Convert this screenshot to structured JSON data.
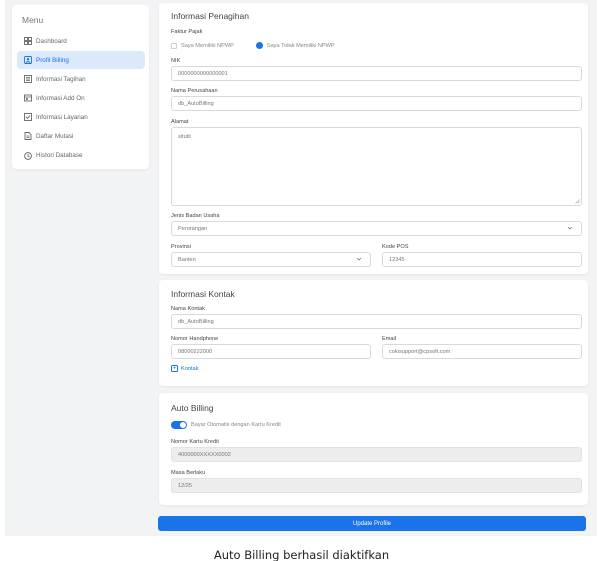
{
  "sidebar": {
    "title": "Menu",
    "items": [
      {
        "label": "Dashboard",
        "icon": "dashboard-icon",
        "active": false
      },
      {
        "label": "Profil Billing",
        "icon": "profile-icon",
        "active": true
      },
      {
        "label": "Informasi Tagihan",
        "icon": "invoice-icon",
        "active": false
      },
      {
        "label": "Informasi Add On",
        "icon": "addon-icon",
        "active": false
      },
      {
        "label": "Informasi Layanan",
        "icon": "service-icon",
        "active": false
      },
      {
        "label": "Daftar Mutasi",
        "icon": "mutation-icon",
        "active": false
      },
      {
        "label": "Histori Database",
        "icon": "history-icon",
        "active": false
      }
    ]
  },
  "billing": {
    "title": "Informasi Penagihan",
    "faktur_label": "Faktur Pajak",
    "option_npwp": "Saya Memiliki NPWP",
    "option_no_npwp": "Saya Tidak Memiliki NPWP",
    "nik_label": "NIK",
    "nik_value": "0000000000000001",
    "company_label": "Nama Perusahaan",
    "company_value": "db_AutoBilling",
    "address_label": "Alamat",
    "address_value": "situtil",
    "business_type_label": "Jenis Badan Usaha",
    "business_type_value": "Perorangan",
    "province_label": "Provinsi",
    "province_value": "Banten",
    "postcode_label": "Kode POS",
    "postcode_value": "12345"
  },
  "contact": {
    "title": "Informasi Kontak",
    "name_label": "Nama Kontak",
    "name_value": "db_AutoBilling",
    "phone_label": "Nomor Handphone",
    "phone_value": "08000222000",
    "email_label": "Email",
    "email_value": "cokisupport@cpsoft.com",
    "add_label": "Kontak"
  },
  "auto_billing": {
    "title": "Auto Billing",
    "toggle_label": "Bayar Otomatis dengan Kartu Kredit",
    "toggle_on": true,
    "card_label": "Nomor Kartu Kredit",
    "card_value": "4000000XXXXX0002",
    "expiry_label": "Masa Berlaku",
    "expiry_value": "12/25"
  },
  "actions": {
    "update_label": "Update Profile"
  },
  "toast": {
    "message": "Auto Billing berhasil diaktifkan"
  },
  "colors": {
    "accent": "#1a73e8",
    "active_bg": "#dbe9fb",
    "page_bg": "#f2f3f5"
  }
}
